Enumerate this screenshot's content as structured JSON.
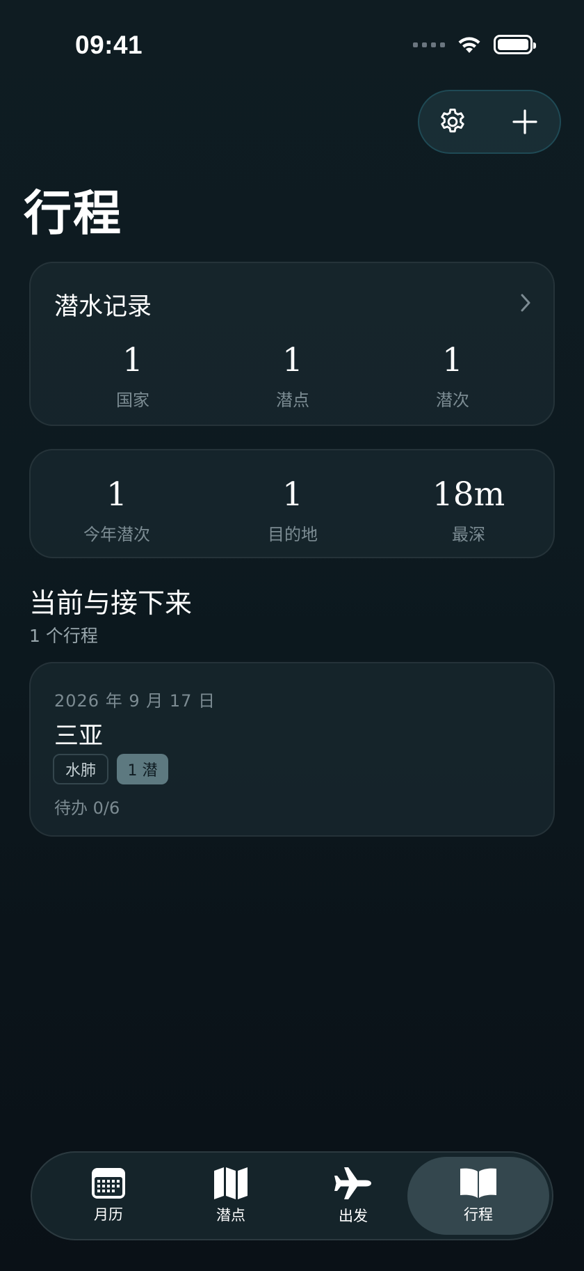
{
  "status_bar": {
    "time": "09:41"
  },
  "top_actions": {
    "settings_icon": "gear-icon",
    "add_icon": "plus-icon"
  },
  "page": {
    "title": "行程"
  },
  "dive_records": {
    "title": "潜水记录",
    "stats": [
      {
        "value": "1",
        "label": "国家"
      },
      {
        "value": "1",
        "label": "潜点"
      },
      {
        "value": "1",
        "label": "潜次"
      }
    ]
  },
  "summary": {
    "stats": [
      {
        "value": "1",
        "label": "今年潜次"
      },
      {
        "value": "1",
        "label": "目的地"
      },
      {
        "value": "18m",
        "label": "最深"
      }
    ]
  },
  "section": {
    "title": "当前与接下来",
    "subtitle": "1 个行程"
  },
  "trip": {
    "date": "2026 年 9 月 17 日",
    "name": "三亚",
    "tags": [
      "水肺",
      "1 潜"
    ],
    "todo": "待办 0/6"
  },
  "tabbar": {
    "active": "行程",
    "tabs": [
      {
        "label": "月历",
        "icon": "calendar-icon"
      },
      {
        "label": "潜点",
        "icon": "map-icon"
      },
      {
        "label": "出发",
        "icon": "airplane-icon"
      },
      {
        "label": "行程",
        "icon": "book-icon"
      }
    ]
  }
}
